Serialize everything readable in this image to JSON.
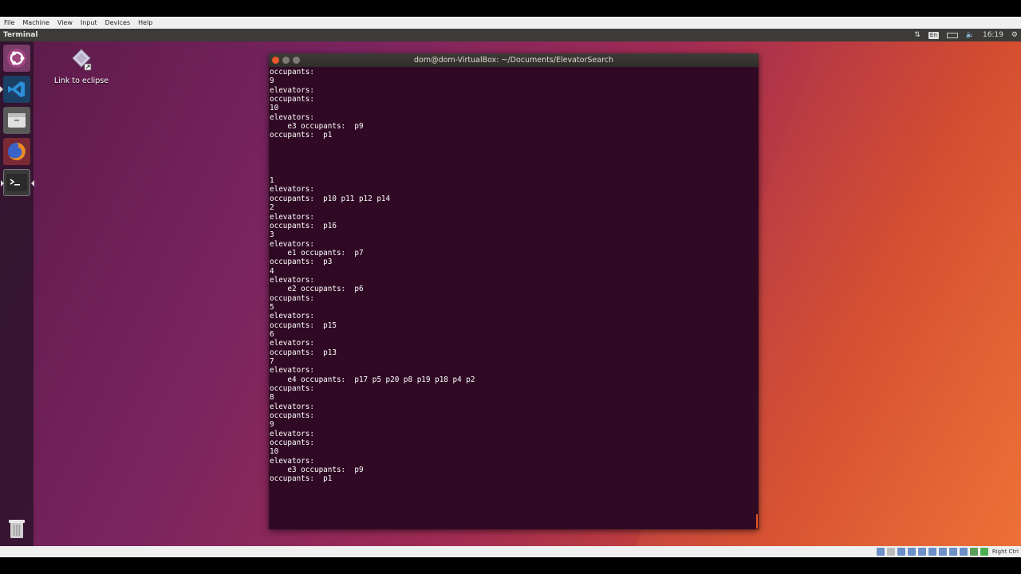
{
  "vbox_menu": {
    "items": [
      "File",
      "Machine",
      "View",
      "Input",
      "Devices",
      "Help"
    ]
  },
  "panel": {
    "app_name": "Terminal",
    "keyboard": "En",
    "time": "16:19",
    "icons": [
      "network-icon",
      "keyboard-icon",
      "battery-icon",
      "volume-icon",
      "power-icon"
    ]
  },
  "launcher": {
    "items": [
      "ubuntu-dash",
      "visual-studio-code",
      "file-manager",
      "firefox",
      "terminal",
      "trash"
    ]
  },
  "desktop_icon": {
    "label": "Link to eclipse"
  },
  "terminal": {
    "title": "dom@dom-VirtualBox: ~/Documents/ElevatorSearch",
    "lines": [
      "occupants:",
      "9",
      "elevators:",
      "occupants:",
      "10",
      "elevators:",
      "    e3 occupants:  p9",
      "occupants:  p1",
      "",
      "",
      "",
      "",
      "1",
      "elevators:",
      "occupants:  p10 p11 p12 p14",
      "2",
      "elevators:",
      "occupants:  p16",
      "3",
      "elevators:",
      "    e1 occupants:  p7",
      "occupants:  p3",
      "4",
      "elevators:",
      "    e2 occupants:  p6",
      "occupants:",
      "5",
      "elevators:",
      "occupants:  p15",
      "6",
      "elevators:",
      "occupants:  p13",
      "7",
      "elevators:",
      "    e4 occupants:  p17 p5 p20 p8 p19 p18 p4 p2",
      "occupants:",
      "8",
      "elevators:",
      "occupants:",
      "9",
      "elevators:",
      "occupants:",
      "10",
      "elevators:",
      "    e3 occupants:  p9",
      "occupants:  p1"
    ]
  },
  "statusbar": {
    "host_key": "Right Ctrl"
  },
  "colors": {
    "terminal_bg": "#300a24",
    "panel_bg": "#3c3b37",
    "accent": "#e95420"
  }
}
